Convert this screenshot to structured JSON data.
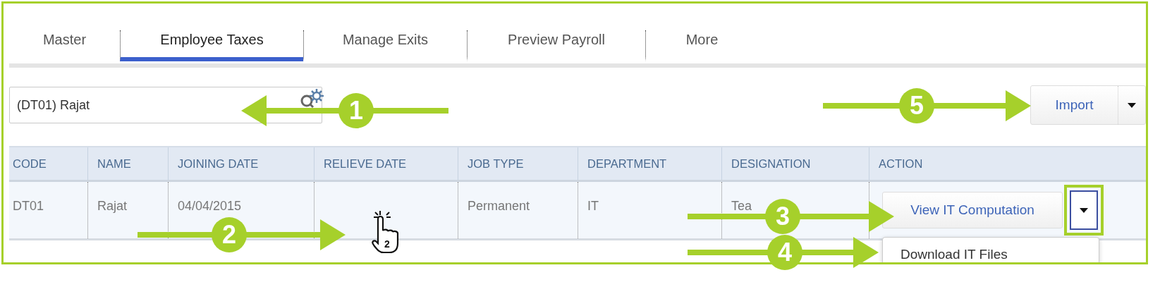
{
  "tabs": [
    {
      "label": "Master",
      "selected": false
    },
    {
      "label": "Employee Taxes",
      "selected": true
    },
    {
      "label": "Manage Exits",
      "selected": false
    },
    {
      "label": "Preview Payroll",
      "selected": false
    },
    {
      "label": "More",
      "selected": false
    }
  ],
  "employee_search": {
    "value": "(DT01) Rajat"
  },
  "import_button": {
    "label": "Import"
  },
  "table": {
    "columns": [
      "CODE",
      "NAME",
      "JOINING DATE",
      "RELIEVE DATE",
      "JOB TYPE",
      "DEPARTMENT",
      "DESIGNATION",
      "ACTION"
    ],
    "rows": [
      {
        "code": "DT01",
        "name": "Rajat",
        "joining_date": "04/04/2015",
        "job_type": "Permanent",
        "department": "IT",
        "designation": "Tea",
        "action": "View IT Computation",
        "caret_highlighted": true
      }
    ]
  },
  "action_menu": {
    "open": true,
    "items": [
      "Download IT Files"
    ]
  },
  "cursor": {
    "click_count": "2"
  },
  "callouts": [
    {
      "number": "1"
    },
    {
      "number": "2"
    },
    {
      "number": "3"
    },
    {
      "number": "4"
    },
    {
      "number": "5"
    }
  ]
}
